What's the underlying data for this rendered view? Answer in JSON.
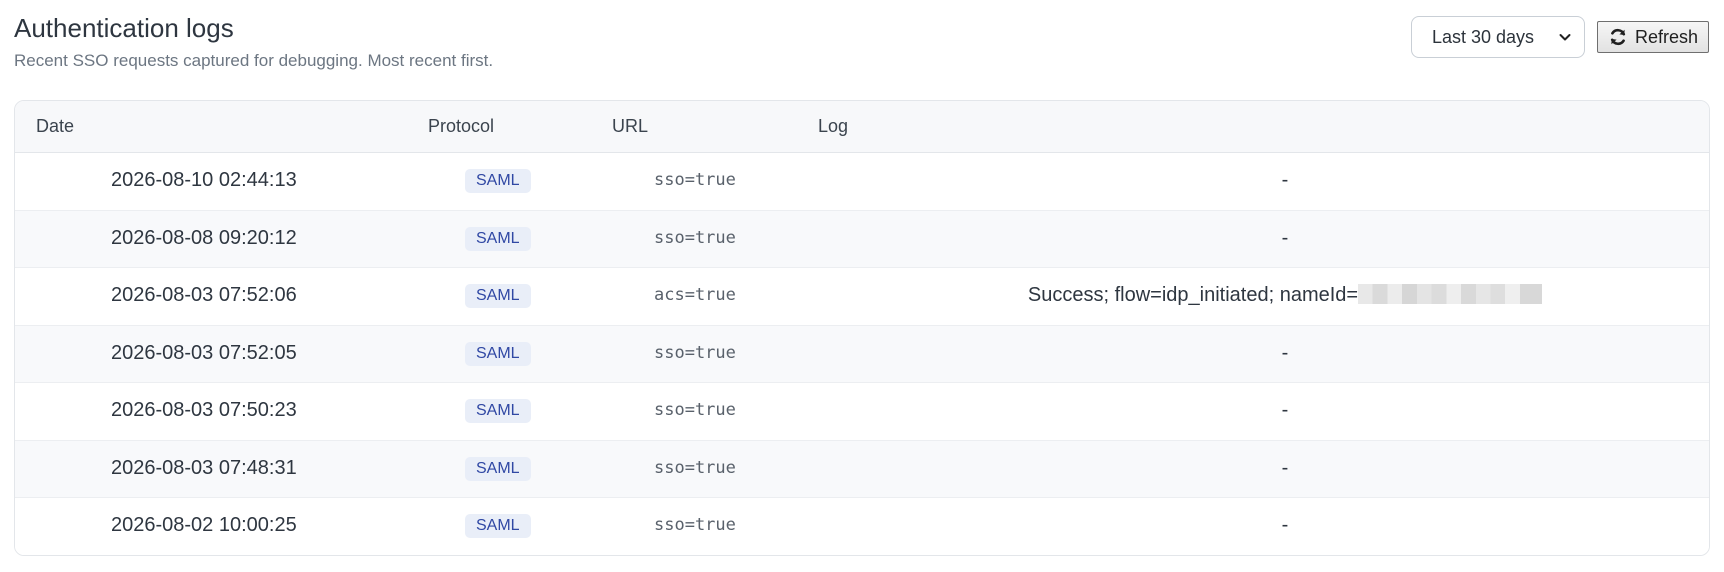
{
  "header": {
    "title": "Authentication logs",
    "subtitle": "Recent SSO requests captured for debugging. Most recent first."
  },
  "controls": {
    "range_selected": "Last 30 days",
    "refresh_label": "Refresh"
  },
  "table": {
    "columns": {
      "date": "Date",
      "protocol": "Protocol",
      "url": "URL",
      "log": "Log"
    },
    "rows": [
      {
        "date": "2026-08-10 02:44:13",
        "protocol": "SAML",
        "url": "sso=true",
        "log": "-"
      },
      {
        "date": "2026-08-08 09:20:12",
        "protocol": "SAML",
        "url": "sso=true",
        "log": "-"
      },
      {
        "date": "2026-08-03 07:52:06",
        "protocol": "SAML",
        "url": "acs=true",
        "log": "Success; flow=idp_initiated; nameId="
      },
      {
        "date": "2026-08-03 07:52:05",
        "protocol": "SAML",
        "url": "sso=true",
        "log": "-"
      },
      {
        "date": "2026-08-03 07:50:23",
        "protocol": "SAML",
        "url": "sso=true",
        "log": "-"
      },
      {
        "date": "2026-08-03 07:48:31",
        "protocol": "SAML",
        "url": "sso=true",
        "log": "-"
      },
      {
        "date": "2026-08-02 10:00:25",
        "protocol": "SAML",
        "url": "sso=true",
        "log": "-"
      }
    ]
  },
  "colors": {
    "protocol_badge_bg": "#e9eef8",
    "protocol_badge_text": "#3048a4",
    "row_alt_bg": "#f8f9fb"
  },
  "icons": {
    "refresh": "refresh-icon",
    "dropdown": "chevron-down-icon",
    "redaction": "redacted-value"
  }
}
